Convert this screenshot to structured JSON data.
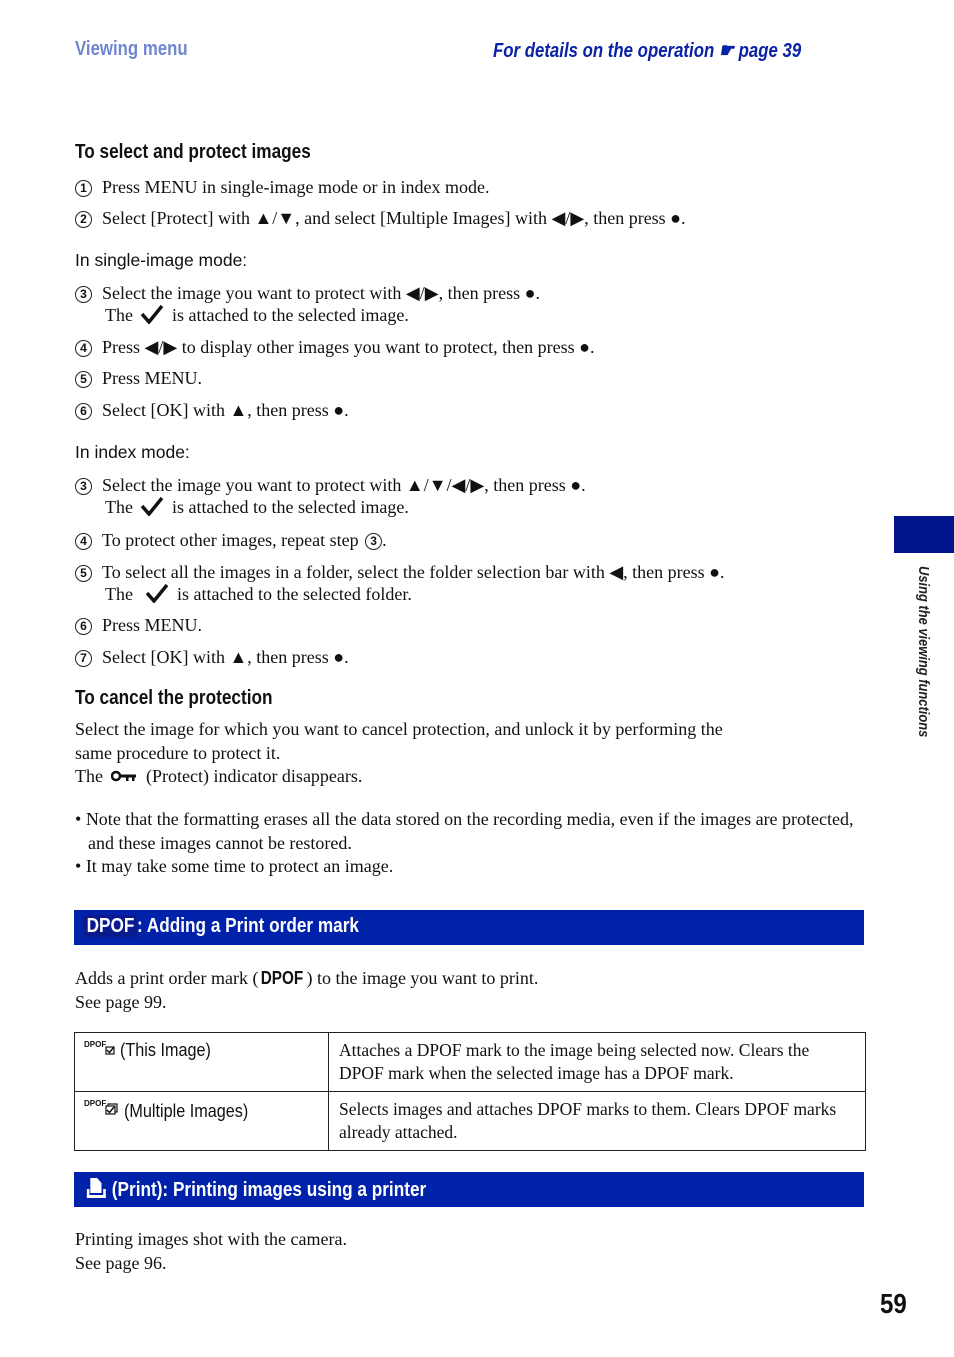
{
  "header": {
    "section": "Viewing menu",
    "reference_prefix": "For details on the operation",
    "reference_icon": "pointing-hand-icon",
    "reference_page": "page 39"
  },
  "protect": {
    "title": "To select and protect images",
    "steps_common": [
      {
        "num": "1",
        "text": "Press MENU in single-image mode or in index mode."
      },
      {
        "num": "2",
        "text": "Select [Protect] with ▲/▼, and select [Multiple Images] with ◀/▶, then press ●."
      }
    ],
    "single_mode": {
      "label": "In single-image mode:",
      "steps": [
        {
          "num": "3",
          "text": "Select the image you want to protect with ◀/▶, then press ●.",
          "note_pre": "The",
          "note_post": "is attached to the selected image."
        },
        {
          "num": "4",
          "text": "Press ◀/▶ to display other images you want to protect, then press ●."
        },
        {
          "num": "5",
          "text": "Press MENU."
        },
        {
          "num": "6",
          "text": "Select [OK] with ▲, then press ●."
        }
      ]
    },
    "index_mode": {
      "label": "In index mode:",
      "steps": [
        {
          "num": "3",
          "text": "Select the image you want to protect with ▲/▼/◀/▶, then press ●.",
          "note_pre": "The",
          "note_post": "is attached to the selected image."
        },
        {
          "num": "4",
          "text": "To protect other images, repeat step",
          "ref": "3",
          "suffix": "."
        },
        {
          "num": "5",
          "text": "To select all the images in a folder, select the folder selection bar with ◀, then press ●.",
          "note_pre": "The",
          "note_post": "is attached to the selected folder."
        },
        {
          "num": "6",
          "text": "Press MENU."
        },
        {
          "num": "7",
          "text": "Select [OK] with ▲, then press ●."
        }
      ]
    }
  },
  "cancel": {
    "title": "To cancel the protection",
    "line1": "Select the image for which you want to cancel protection, and unlock it by performing the",
    "line2": "same procedure to protect it.",
    "line3_pre": "The",
    "line3_post": "(Protect) indicator disappears.",
    "notes": [
      "Note that the formatting erases all the data stored on the recording media, even if the images are protected, and these images cannot be restored.",
      "It may take some time to protect an image."
    ]
  },
  "dpof": {
    "badge": "DPOF",
    "title": ": Adding a Print order mark",
    "desc_pre": "Adds a print order mark (",
    "desc_badge": "DPOF",
    "desc_post": ") to the image you want to print.",
    "see": "See page 99.",
    "options": [
      {
        "icon": "dpof-this-image-icon",
        "label": "(This Image)",
        "description": "Attaches a DPOF mark to the image being selected now. Clears the DPOF mark when the selected image has a DPOF mark."
      },
      {
        "icon": "dpof-multiple-images-icon",
        "label": "(Multiple Images)",
        "description": "Selects images and attaches DPOF marks to them. Clears DPOF marks already attached."
      }
    ]
  },
  "print": {
    "title": "(Print): Printing images using a printer",
    "desc": "Printing images shot with the camera.",
    "see": "See page 96."
  },
  "sidebar": {
    "label": "Using the viewing functions"
  },
  "page_number": "59",
  "colors": {
    "section_header": "#6f86d0",
    "reference": "#0a22a6",
    "bar": "#0021a9",
    "side_tab": "#00148c"
  }
}
